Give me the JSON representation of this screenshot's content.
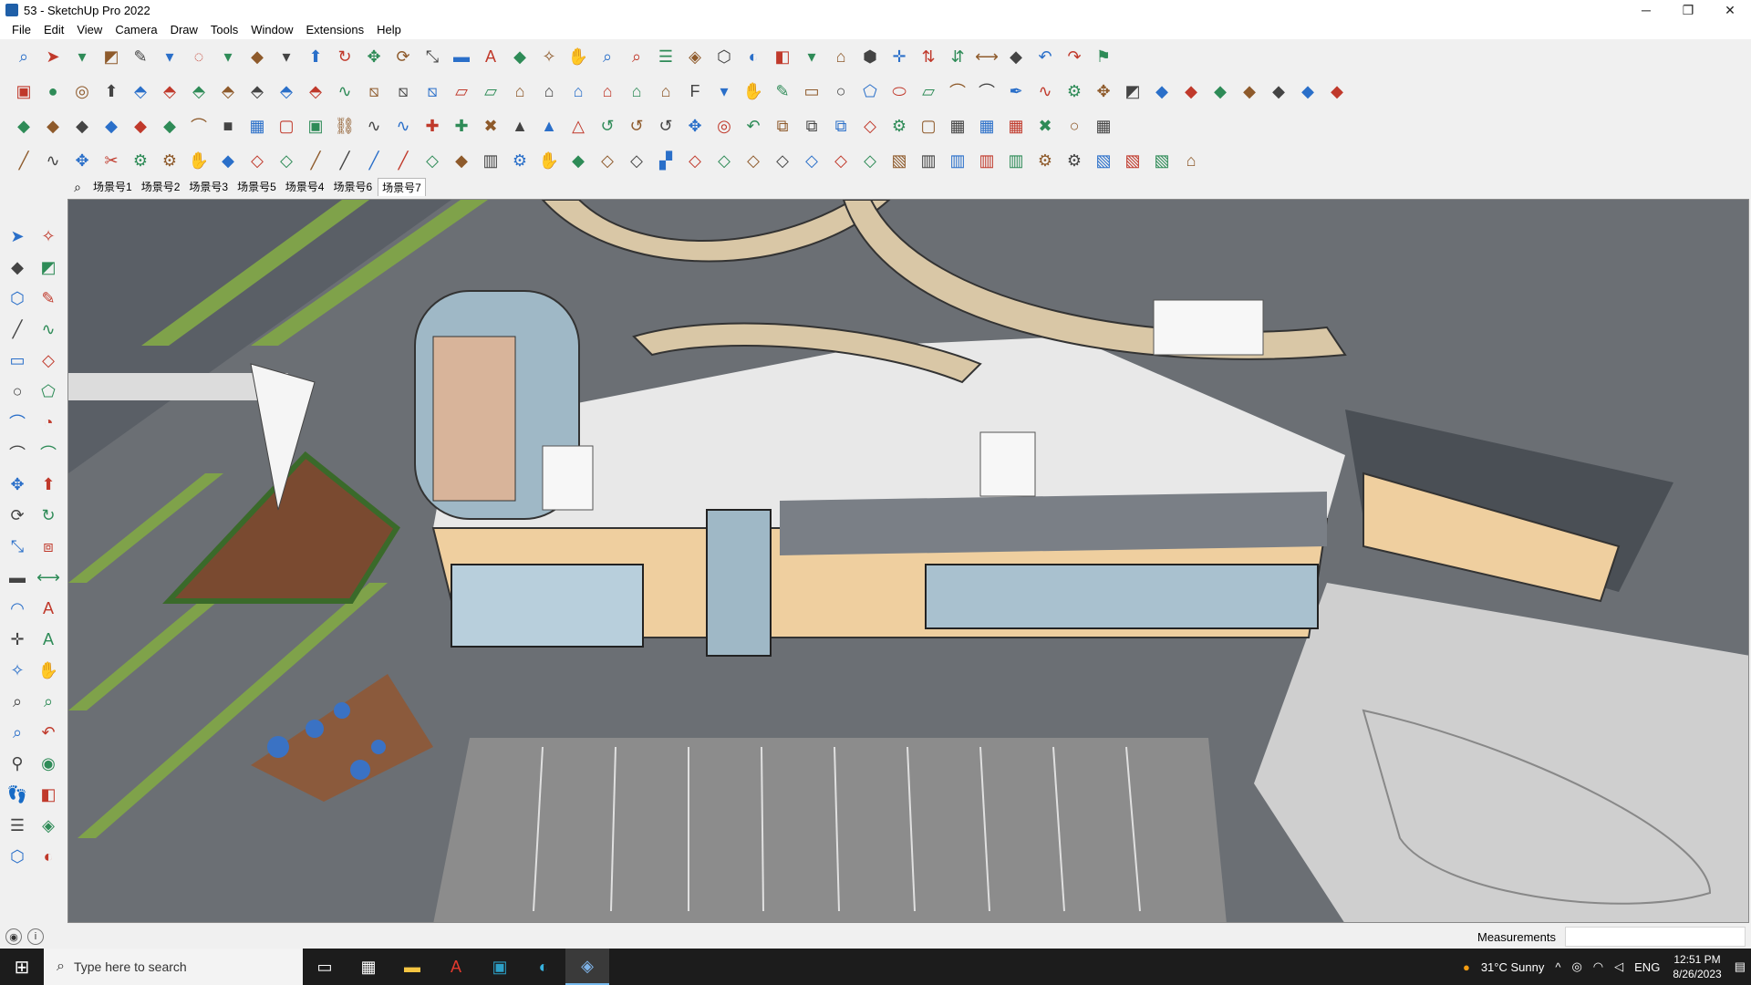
{
  "window": {
    "title": "53 - SketchUp Pro 2022",
    "controls": {
      "minimize": "─",
      "maximize": "❐",
      "close": "✕"
    }
  },
  "menu": [
    "File",
    "Edit",
    "View",
    "Camera",
    "Draw",
    "Tools",
    "Window",
    "Extensions",
    "Help"
  ],
  "toolbar_rows": [
    {
      "icons": [
        "zoom-icon",
        "select-icon",
        "dropdown-icon",
        "eraser-icon",
        "pencil-icon",
        "dropdown-icon",
        "lasso-icon",
        "dropdown-icon",
        "paint-bucket-icon",
        "dropdown-icon",
        "push-pull-icon",
        "follow-me-icon",
        "move-icon",
        "rotate-icon",
        "scale-icon",
        "tape-measure-icon",
        "text-icon",
        "paint-icon",
        "orbit-icon",
        "pan-icon",
        "zoom-window-icon",
        "zoom-extents-icon",
        "layers-icon",
        "styles-icon",
        "components-icon",
        "shadows-icon",
        "section-icon",
        "dropdown-icon",
        "warehouse-icon",
        "extension-icon",
        "axis-icon",
        "up-down-icon",
        "arrows-icon",
        "dimension-icon",
        "solid-icon",
        "undo-icon",
        "redo-icon",
        "tag-icon"
      ]
    },
    {
      "icons": [
        "box-icon",
        "sphere-icon",
        "cylinder-icon",
        "push-icon",
        "extrude-icon",
        "extrude-icon",
        "extrude-icon",
        "extrude-icon",
        "extrude-icon",
        "extrude-icon",
        "extrude-icon",
        "curve-icon",
        "slice-icon",
        "slice-icon",
        "slice-icon",
        "terrain-icon",
        "terrain-icon",
        "house-icon",
        "house-icon",
        "house-icon",
        "house-icon",
        "house-icon",
        "house-icon",
        "font-icon",
        "dropdown-icon",
        "hand-icon",
        "pencil-icon",
        "rect-icon",
        "circle-icon",
        "polygon-icon",
        "ellipse-icon",
        "parallelogram-icon",
        "arc-icon",
        "arc-icon",
        "pen-icon",
        "curve-icon",
        "gear-icon",
        "move-icon",
        "eraser-icon",
        "solid-icon",
        "solid-icon",
        "solid-icon",
        "solid-icon",
        "solid-icon",
        "solid-icon",
        "solid-icon"
      ]
    },
    {
      "icons": [
        "face-icon",
        "face-icon",
        "face-icon",
        "face-icon",
        "face-icon",
        "face-icon",
        "arc-icon",
        "square-icon",
        "grid-icon",
        "frame-icon",
        "box-icon",
        "link-icon",
        "curve-icon",
        "curve-icon",
        "plus-icon",
        "plus-icon",
        "cross-icon",
        "cone-icon",
        "cone-icon",
        "triangle-icon",
        "hook-icon",
        "hook-icon",
        "hook-icon",
        "move-icon",
        "cylinder-icon",
        "undo-icon",
        "puzzle-icon",
        "puzzle-icon",
        "puzzle-icon",
        "gem-icon",
        "gear-icon",
        "frame-icon",
        "grid-icon",
        "grid-icon",
        "grid-icon",
        "cross-icon",
        "circle-icon",
        "grid-icon"
      ]
    },
    {
      "icons": [
        "line-icon",
        "curve-icon",
        "move-icon",
        "scissors-icon",
        "gear-icon",
        "gear-icon",
        "hand-icon",
        "face-icon",
        "shape-icon",
        "shape-icon",
        "line-icon",
        "line-icon",
        "line-icon",
        "line-icon",
        "shape-icon",
        "face-icon",
        "bars-icon",
        "gear-icon",
        "hand-icon",
        "face-icon",
        "shape-icon",
        "shape-icon",
        "stairs-icon",
        "shape-icon",
        "shape-icon",
        "shape-icon",
        "shape-icon",
        "shape-icon",
        "shape-icon",
        "shape-icon",
        "hatch-icon",
        "bars-icon",
        "bars-icon",
        "bars-icon",
        "bars-icon",
        "gear-icon",
        "gear-icon",
        "hatch-icon",
        "hatch-icon",
        "hatch-icon",
        "house-icon"
      ]
    }
  ],
  "scene_tabs": [
    "场景号1",
    "场景号2",
    "场景号3",
    "场景号5",
    "场景号4",
    "场景号6",
    "场景号7"
  ],
  "active_scene": "场景号7",
  "left_toolbar": [
    "select-icon",
    "orbit-icon",
    "paint-bucket-icon",
    "eraser-icon",
    "component-icon",
    "pencil-icon",
    "line-icon",
    "freehand-icon",
    "rectangle-icon",
    "rotated-rect-icon",
    "circle-icon",
    "polygon-icon",
    "arc-icon",
    "pie-icon",
    "arc2-icon",
    "arc3-icon",
    "move-icon",
    "push-pull-icon",
    "rotate-icon",
    "follow-me-icon",
    "scale-icon",
    "offset-icon",
    "tape-measure-icon",
    "dimension-icon",
    "protractor-icon",
    "text-icon",
    "axes-icon",
    "3d-text-icon",
    "orbit-icon",
    "pan-icon",
    "zoom-icon",
    "zoom-window-icon",
    "zoom-extents-icon",
    "previous-icon",
    "position-camera-icon",
    "look-around-icon",
    "walk-icon",
    "section-plane-icon",
    "layers-icon",
    "styles-icon",
    "components-icon",
    "shadows-icon"
  ],
  "statusbar": {
    "measurements_label": "Measurements",
    "measurements_value": ""
  },
  "taskbar": {
    "search_placeholder": "Type here to search",
    "weather": "31°C  Sunny",
    "language": "ENG",
    "time": "12:51 PM",
    "date": "8/26/2023",
    "apps": [
      "task-view-icon",
      "calculator-icon",
      "file-explorer-icon",
      "acrobat-icon",
      "app-icon",
      "edge-icon",
      "sketchup-icon"
    ]
  },
  "colors": {
    "accent": "#1f5fa8",
    "taskbar": "#1c1c1c",
    "toolbar": "#f0f0f0"
  }
}
